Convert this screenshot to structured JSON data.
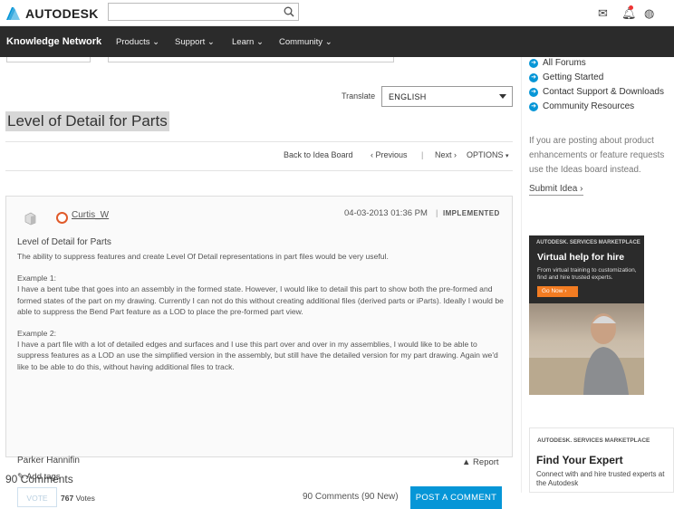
{
  "header": {
    "logo_text": "AUTODESK",
    "search_value": "",
    "icons": [
      "mail-icon",
      "bell-icon",
      "globe-icon"
    ]
  },
  "nav": {
    "brand": "Knowledge Network",
    "items": [
      {
        "label": "Products"
      },
      {
        "label": "Support"
      },
      {
        "label": "Learn"
      },
      {
        "label": "Community"
      }
    ]
  },
  "translate": {
    "label": "Translate",
    "selected": "ENGLISH"
  },
  "idea": {
    "title": "Level of Detail for Parts",
    "back_link": "Back to Idea Board",
    "prev": "Previous",
    "next": "Next",
    "options": "OPTIONS",
    "separator": "|"
  },
  "post": {
    "username": "Curtis_W",
    "date": "04-03-2013 01:36 PM",
    "status": "IMPLEMENTED",
    "subject": "Level of Detail for Parts",
    "paragraphs": [
      "The ability to suppress features and create Level Of Detail representations in part files would be very useful.",
      "Example 1:\nI have a bent tube that goes into an assembly in the formed state. However, I would like to detail this part to show both the pre-formed and formed states of the part on my drawing. Currently I can not do this without creating additional files (derived parts or iParts).  Ideally I would be able to suppress the Bend Part feature as a LOD to place the pre-formed part view.",
      "Example 2:\nI have a part file with a lot of detailed edges and surfaces and I use this part over and over in my assemblies, I would like to be able to suppress features as a LOD an use the simplified version in the assembly, but still have the detailed version for my part drawing. Again we'd like to be able to do this, without having additional files to track."
    ],
    "author_company": "Parker Hannifin",
    "report": "Report",
    "add_tags": "Add tags",
    "vote_label": "VOTE",
    "votes_count": "767",
    "votes_word": "Votes",
    "comments_count": "90 Comments (90 New)",
    "post_comment": "POST A COMMENT"
  },
  "comments_heading": "90 Comments",
  "sidebar": {
    "links": [
      {
        "label": "All Forums"
      },
      {
        "label": "Getting Started"
      },
      {
        "label": "Contact Support & Downloads"
      },
      {
        "label": "Community Resources"
      }
    ],
    "ideas_note": "If you are posting about product enhancements or feature requests use the Ideas board instead.",
    "submit_idea": "Submit Idea",
    "ad1": {
      "brand": "AUTODESK. SERVICES MARKETPLACE",
      "headline": "Virtual help for hire",
      "sub": "From virtual training to customization, find and hire trusted experts.",
      "cta": "Go Now"
    },
    "ad2": {
      "brand": "AUTODESK. SERVICES MARKETPLACE",
      "headline": "Find Your Expert",
      "sub": "Connect with and hire trusted experts at the Autodesk"
    }
  },
  "colors": {
    "accent": "#0696d7",
    "nav_bg": "#2b2b2b",
    "cta_orange": "#f37c22",
    "badge": "#e05a2a"
  }
}
